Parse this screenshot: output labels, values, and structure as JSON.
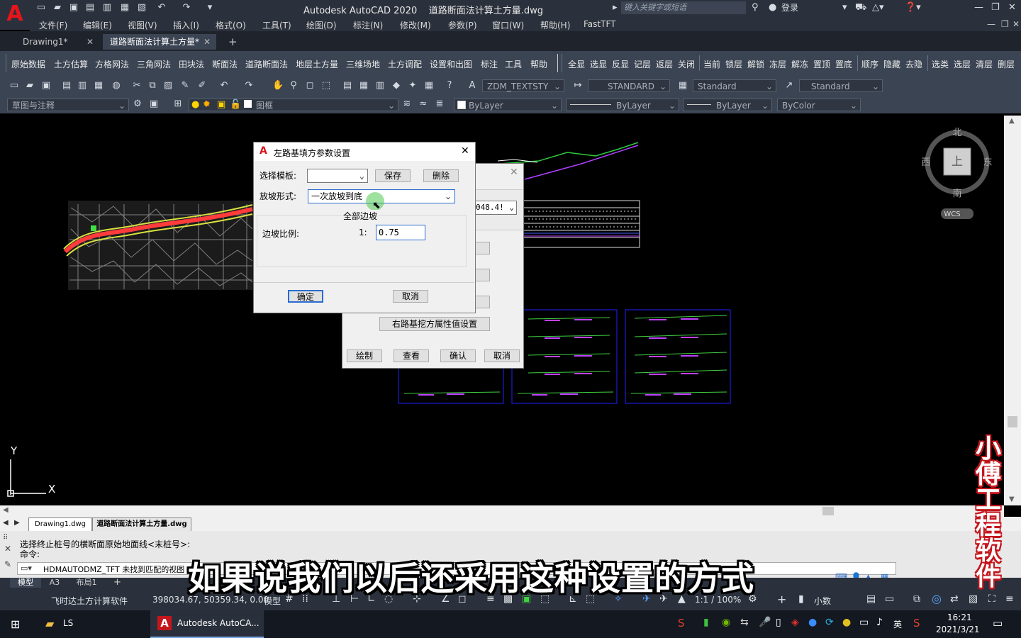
{
  "app": {
    "logo": "A",
    "title": "Autodesk AutoCAD 2020",
    "filename": "道路断面法计算土方量.dwg",
    "search_placeholder": "键入关键字或短语",
    "login": "登录"
  },
  "menu": [
    "文件(F)",
    "编辑(E)",
    "视图(V)",
    "插入(I)",
    "格式(O)",
    "工具(T)",
    "绘图(D)",
    "标注(N)",
    "修改(M)",
    "参数(P)",
    "窗口(W)",
    "帮助(H)",
    "FastTFT"
  ],
  "tabs": [
    {
      "label": "Drawing1*"
    },
    {
      "label": "道路断面法计算土方量*"
    }
  ],
  "tab_add": "+",
  "commands": [
    "原始数据",
    "土方估算",
    "方格网法",
    "三角网法",
    "田块法",
    "断面法",
    "道路断面法",
    "地层土方量",
    "三维场地",
    "土方调配",
    "设置和出图",
    "标注",
    "工具",
    "帮助"
  ],
  "layer_commands": [
    "全显",
    "选显",
    "反显",
    "记层",
    "返层",
    "关闭",
    "当前",
    "锁层",
    "解锁",
    "冻层",
    "解冻",
    "置顶",
    "置底",
    "顺序",
    "隐藏",
    "去隐",
    "选类",
    "选层",
    "清层",
    "删层"
  ],
  "toolbar": {
    "text_style": "ZDM_TEXTSTY",
    "dim_style": "STANDARD",
    "table_style": "Standard",
    "mleader_style": "Standard"
  },
  "layers_row": {
    "workspace": "草图与注释",
    "layer": "图框",
    "color": "ByLayer",
    "linetype": "ByLayer",
    "lineweight": "ByLayer",
    "plotstyle": "ByColor"
  },
  "viewcube": {
    "north": "北",
    "south": "南",
    "east": "东",
    "west": "西",
    "top": "上",
    "wcs": "WCS"
  },
  "ucs": {
    "y": "Y",
    "x": "X"
  },
  "back_dialog": {
    "value": "048.4!",
    "right_btn": "右路基挖方属性值设置",
    "draw": "绘制",
    "view": "查看",
    "confirm": "确认",
    "cancel": "取消"
  },
  "dialog": {
    "title": "左路基填方参数设置",
    "template_label": "选择模板:",
    "template_value": "",
    "save": "保存",
    "delete": "删除",
    "slope_form_label": "放坡形式:",
    "slope_form_value": "一次放坡到底",
    "group_title": "全部边坡",
    "ratio_label": "边坡比例:",
    "ratio_prefix": "1:",
    "ratio_value": "0.75",
    "ok": "确定",
    "cancel": "取消"
  },
  "layout_files": [
    "Drawing1.dwg",
    "道路断面法计算土方量.dwg"
  ],
  "command_history": [
    "选择终止桩号的横断面原始地面线<末桩号>:",
    "命令:"
  ],
  "command_input": "HDMAUTODMZ_TFT 未找到匹配的视图",
  "layout_tabs": [
    "模型",
    "A3",
    "布局1"
  ],
  "status": {
    "software": "飞时达土方计算软件",
    "coords": "398034.67, 50359.34, 0.00",
    "model": "模型",
    "scale": "1:1 / 100%",
    "units": "小数"
  },
  "taskbar": {
    "folder": "LS",
    "app": "Autodesk AutoCA...",
    "ime": "英",
    "time": "16:21",
    "date": "2021/3/21"
  },
  "subtitle": "如果说我们以后还采用这种设置的方式",
  "watermark": "小傅工程软件"
}
